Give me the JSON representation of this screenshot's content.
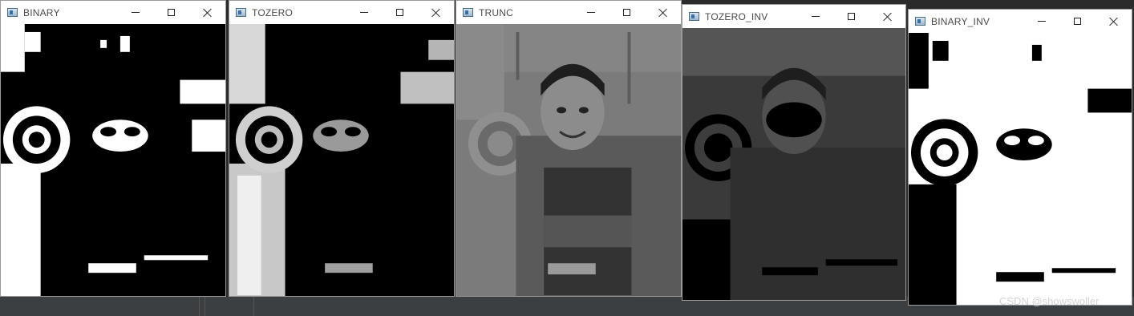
{
  "windows": [
    {
      "title": "BINARY",
      "mode": "binary"
    },
    {
      "title": "TOZERO",
      "mode": "tozero"
    },
    {
      "title": "TRUNC",
      "mode": "trunc"
    },
    {
      "title": "TOZERO_INV",
      "mode": "tozero_inv"
    },
    {
      "title": "BINARY_INV",
      "mode": "binary_inv"
    }
  ],
  "icons": {
    "app": "image-window-icon",
    "minimize": "minimize-icon",
    "maximize": "maximize-icon",
    "close": "close-icon"
  },
  "watermark": "CSDN @showswoller"
}
